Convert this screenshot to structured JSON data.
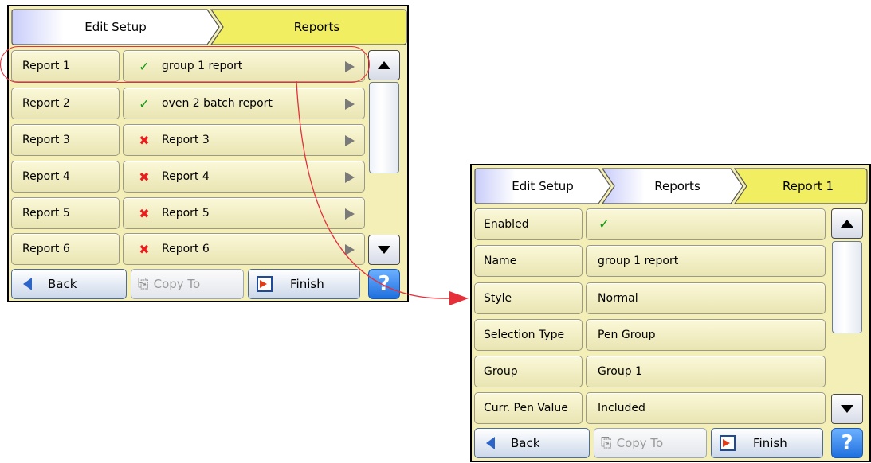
{
  "screen1": {
    "breadcrumbs": [
      "Edit Setup",
      "Reports"
    ],
    "rows": [
      {
        "label": "Report 1",
        "enabled": true,
        "value": "group 1 report"
      },
      {
        "label": "Report 2",
        "enabled": true,
        "value": "oven 2 batch report"
      },
      {
        "label": "Report 3",
        "enabled": false,
        "value": "Report 3"
      },
      {
        "label": "Report 4",
        "enabled": false,
        "value": "Report 4"
      },
      {
        "label": "Report 5",
        "enabled": false,
        "value": "Report 5"
      },
      {
        "label": "Report 6",
        "enabled": false,
        "value": "Report 6"
      }
    ],
    "buttons": {
      "back": "Back",
      "copy_to": "Copy To",
      "finish": "Finish",
      "help": "?"
    }
  },
  "screen2": {
    "breadcrumbs": [
      "Edit Setup",
      "Reports",
      "Report 1"
    ],
    "rows": [
      {
        "label": "Enabled",
        "value": "✓"
      },
      {
        "label": "Name",
        "value": "group 1 report"
      },
      {
        "label": "Style",
        "value": "Normal"
      },
      {
        "label": "Selection Type",
        "value": "Pen Group"
      },
      {
        "label": "Group",
        "value": "Group 1"
      },
      {
        "label": "Curr. Pen Value",
        "value": "Included"
      }
    ],
    "buttons": {
      "back": "Back",
      "copy_to": "Copy To",
      "finish": "Finish",
      "help": "?"
    }
  },
  "icons": {
    "enabled": "check-icon",
    "disabled": "cross-icon",
    "row_arrow": "play-arrow-icon"
  },
  "colors": {
    "panel": "#f3efb6",
    "active_crumb": "#f1ee62",
    "check": "#159a15",
    "cross": "#e81e1e",
    "highlight": "#e5303a",
    "help": "#1f6fde"
  }
}
